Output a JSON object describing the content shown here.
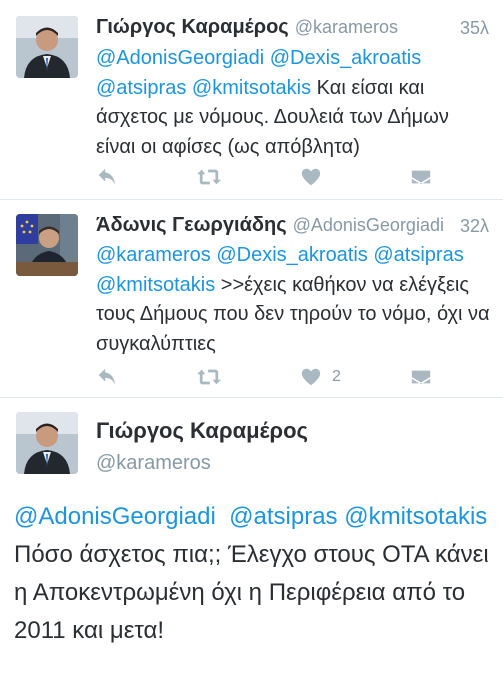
{
  "tweets": [
    {
      "name": "Γιώργος Καραμέρος",
      "handle": "@karameros",
      "time": "35λ",
      "text_parts": [
        {
          "t": "@AdonisGeorgiadi",
          "m": true
        },
        {
          "t": " ",
          "m": false
        },
        {
          "t": "@Dexis_akroatis",
          "m": true
        },
        {
          "t": " ",
          "m": false
        },
        {
          "t": "@atsipras",
          "m": true
        },
        {
          "t": " ",
          "m": false
        },
        {
          "t": "@kmitsotakis",
          "m": true
        },
        {
          "t": " Και είσαι και άσχετος με νόμους. Δουλειά των Δήμων είναι οι αφίσες (ως απόβλητα)",
          "m": false
        }
      ],
      "like_count": ""
    },
    {
      "name": "Άδωνις Γεωργιάδης",
      "handle": "@AdonisGeorgiadi",
      "time": "32λ",
      "text_parts": [
        {
          "t": "@karameros",
          "m": true
        },
        {
          "t": " ",
          "m": false
        },
        {
          "t": "@Dexis_akroatis",
          "m": true
        },
        {
          "t": " ",
          "m": false
        },
        {
          "t": "@atsipras",
          "m": true
        },
        {
          "t": " ",
          "m": false
        },
        {
          "t": "@kmitsotakis",
          "m": true
        },
        {
          "t": " >>έχεις καθήκον να ελέγξεις τους Δήμους που δεν τηρούν το νόμο, όχι να συγκαλύπτιες",
          "m": false
        }
      ],
      "like_count": "2"
    }
  ],
  "expanded": {
    "name": "Γιώργος Καραμέρος",
    "handle": "@karameros",
    "text_parts": [
      {
        "t": "@AdonisGeorgiadi",
        "m": true
      },
      {
        "t": "  ",
        "m": false
      },
      {
        "t": "@atsipras",
        "m": true
      },
      {
        "t": " ",
        "m": false
      },
      {
        "t": "@kmitsotakis",
        "m": true
      },
      {
        "t": " Πόσο άσχετος πια;; Έλεγχο στους ΟΤΑ κάνει η Αποκεντρωμένη όχι η Περιφέρεια από το 2011 και μετα!",
        "m": false
      }
    ]
  },
  "icons": {
    "reply": "reply-icon",
    "retweet": "retweet-icon",
    "like": "heart-icon",
    "dm": "envelope-icon"
  },
  "colors": {
    "mention": "#1b95e0",
    "muted": "#8899a6",
    "icon": "#aab8c2",
    "text": "#292f33"
  }
}
